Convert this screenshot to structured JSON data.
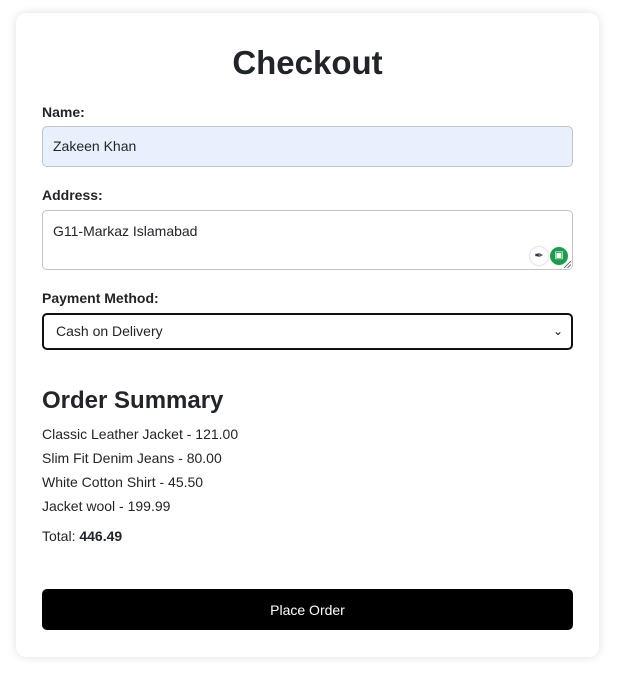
{
  "checkout": {
    "title": "Checkout",
    "name_label": "Name:",
    "name_value": "Zakeen Khan",
    "address_label": "Address:",
    "address_value": "G11-Markaz Islamabad",
    "payment_label": "Payment Method:",
    "payment_selected": "Cash on Delivery"
  },
  "summary": {
    "title": "Order Summary",
    "items": [
      "Classic Leather Jacket - 121.00",
      "Slim Fit Denim Jeans - 80.00",
      "White Cotton Shirt - 45.50",
      "Jacket wool - 199.99"
    ],
    "total_label": "Total:",
    "total_value": "446.49"
  },
  "actions": {
    "place_order_label": "Place Order"
  },
  "icons": {
    "select_chevron": "chevron-down-icon",
    "extension_pen": "pen-icon",
    "extension_bot": "bot-icon"
  },
  "colors": {
    "autofill_bg": "#e8f0fe",
    "button_bg": "#000000",
    "extension_green": "#1a9e4b"
  }
}
